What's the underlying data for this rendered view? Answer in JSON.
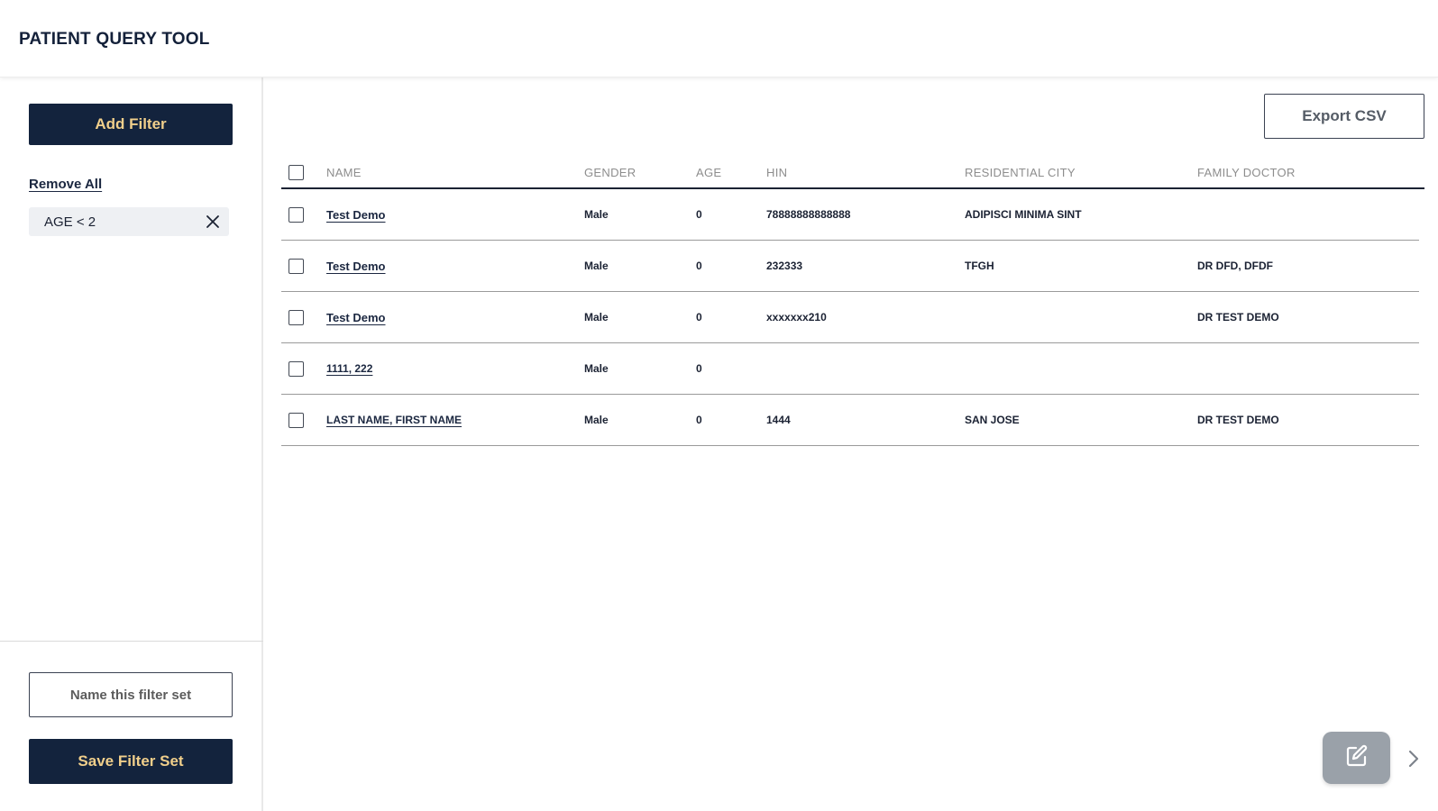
{
  "header": {
    "title": "PATIENT QUERY TOOL"
  },
  "sidebar": {
    "add_filter_label": "Add Filter",
    "remove_all_label": "Remove All",
    "filters": [
      {
        "label": "AGE < 2"
      }
    ],
    "filter_set_name": {
      "value": "",
      "placeholder": "Name this filter set"
    },
    "save_filter_set_label": "Save Filter Set"
  },
  "main": {
    "export_label": "Export CSV",
    "table": {
      "columns": [
        "NAME",
        "GENDER",
        "AGE",
        "HIN",
        "RESIDENTIAL CITY",
        "FAMILY DOCTOR"
      ],
      "rows": [
        {
          "name": "Test Demo",
          "gender": "Male",
          "age": "0",
          "hin": "78888888888888",
          "city": "ADIPISCI MINIMA SINT",
          "doctor": ""
        },
        {
          "name": "Test Demo",
          "gender": "Male",
          "age": "0",
          "hin": "232333",
          "city": "TFGH",
          "doctor": "DR DFD, DFDF"
        },
        {
          "name": "Test Demo",
          "gender": "Male",
          "age": "0",
          "hin": "xxxxxxx210",
          "city": "",
          "doctor": "DR TEST DEMO"
        },
        {
          "name": "1111, 222",
          "gender": "Male",
          "age": "0",
          "hin": "",
          "city": "",
          "doctor": ""
        },
        {
          "name": "LAST NAME, FIRST NAME",
          "gender": "Male",
          "age": "0",
          "hin": "1444",
          "city": "SAN JOSE",
          "doctor": "DR TEST DEMO"
        }
      ]
    }
  },
  "icons": {
    "remove_filter": "close-icon",
    "edit": "edit-icon",
    "next": "chevron-right-icon"
  },
  "colors": {
    "primary": "#13233d",
    "primary_text": "#f1cf8b",
    "fab": "#9aa1a9"
  }
}
